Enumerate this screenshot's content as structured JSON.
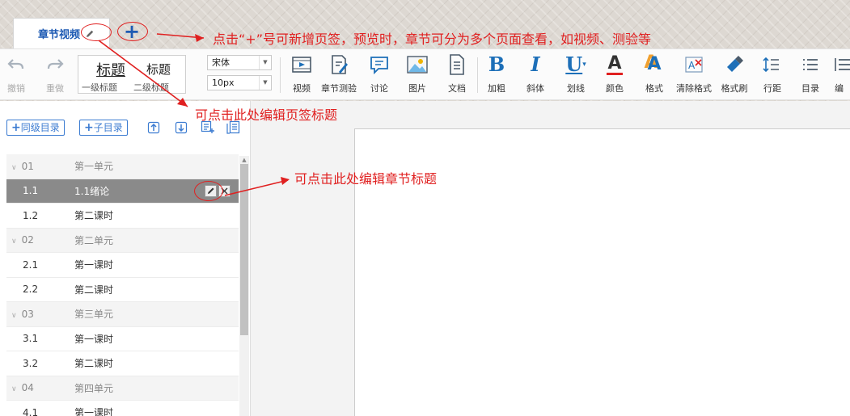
{
  "tabs": [
    {
      "label": "章节视频"
    }
  ],
  "annotations": {
    "add_tab": "点击“+”号可新增页签，预览时，章节可分为多个页面查看，如视频、测验等",
    "edit_tab": "可点击此处编辑页签标题",
    "edit_chapter": "可点击此处编辑章节标题"
  },
  "toolbar": {
    "undo": "撤销",
    "redo": "重做",
    "heading1": "标题",
    "heading2": "标题",
    "heading1_sub": "一级标题",
    "heading2_sub": "二级标题",
    "font_family": "宋体",
    "font_size": "10px",
    "buttons": [
      {
        "label": "视频",
        "icon": "video-icon"
      },
      {
        "label": "章节测验",
        "icon": "quiz-icon"
      },
      {
        "label": "讨论",
        "icon": "discussion-icon"
      },
      {
        "label": "图片",
        "icon": "image-icon"
      },
      {
        "label": "文档",
        "icon": "document-icon"
      },
      {
        "label": "加粗",
        "icon": "bold-icon",
        "glyph": "B"
      },
      {
        "label": "斜体",
        "icon": "italic-icon",
        "glyph": "I"
      },
      {
        "label": "划线",
        "icon": "underline-icon",
        "glyph": "U"
      },
      {
        "label": "颜色",
        "icon": "font-color-icon",
        "glyph": "A"
      },
      {
        "label": "格式",
        "icon": "format-icon",
        "glyph": "A"
      },
      {
        "label": "清除格式",
        "icon": "clear-format-icon"
      },
      {
        "label": "格式刷",
        "icon": "format-painter-icon"
      },
      {
        "label": "行距",
        "icon": "line-spacing-icon"
      },
      {
        "label": "目录",
        "icon": "toc-icon"
      },
      {
        "label": "编",
        "icon": "numbering-icon"
      }
    ]
  },
  "sidebar": {
    "add_sibling": "同级目录",
    "add_child": "子目录",
    "items": [
      {
        "num": "01",
        "title": "第一单元",
        "type": "unit"
      },
      {
        "num": "1.1",
        "title": "1.1绪论",
        "type": "lesson",
        "active": true
      },
      {
        "num": "1.2",
        "title": "第二课时",
        "type": "lesson"
      },
      {
        "num": "02",
        "title": "第二单元",
        "type": "unit"
      },
      {
        "num": "2.1",
        "title": "第一课时",
        "type": "lesson"
      },
      {
        "num": "2.2",
        "title": "第二课时",
        "type": "lesson"
      },
      {
        "num": "03",
        "title": "第三单元",
        "type": "unit"
      },
      {
        "num": "3.1",
        "title": "第一课时",
        "type": "lesson"
      },
      {
        "num": "3.2",
        "title": "第二课时",
        "type": "lesson"
      },
      {
        "num": "04",
        "title": "第四单元",
        "type": "unit"
      },
      {
        "num": "4.1",
        "title": "第一课时",
        "type": "lesson"
      }
    ]
  },
  "colors": {
    "annotation": "#e02020",
    "accent": "#1d5ab3",
    "toolbar_icon": "#1d6fb8",
    "active_row": "#8a8a8a"
  }
}
